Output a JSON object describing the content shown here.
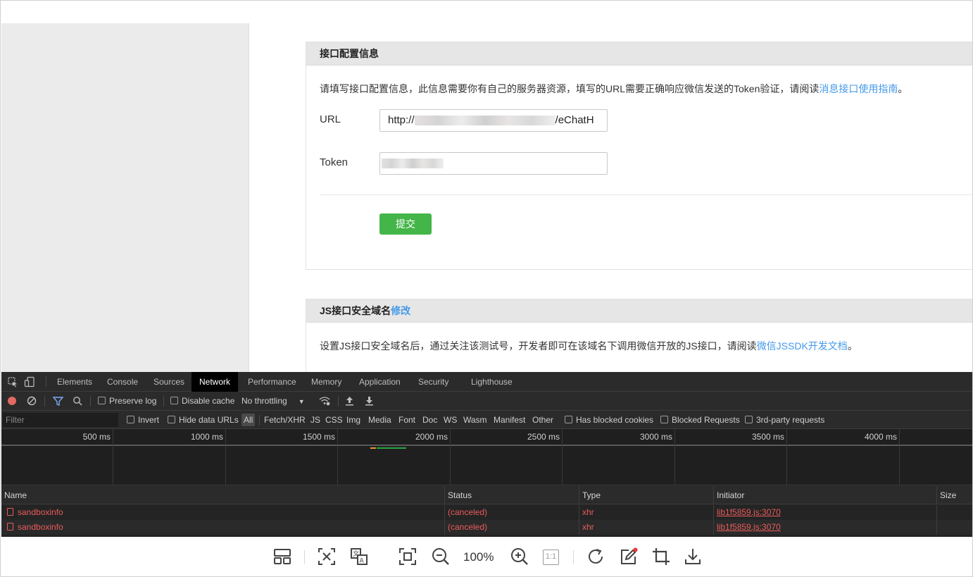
{
  "page": {
    "panel1": {
      "title": "接口配置信息",
      "desc_prefix": "请填写接口配置信息，此信息需要你有自己的服务器资源，填写的URL需要正确响应微信发送的Token验证，请阅读",
      "desc_link": "消息接口使用指南",
      "desc_suffix": "。",
      "url_label": "URL",
      "url_value_start": "http://",
      "url_value_end": "/eChatH",
      "token_label": "Token",
      "submit_label": "提交"
    },
    "panel2": {
      "title": "JS接口安全域名",
      "title_link": "修改",
      "desc_prefix": "设置JS接口安全域名后，通过关注该测试号，开发者即可在该域名下调用微信开放的JS接口，请阅读",
      "desc_link": "微信JSSDK开发文档",
      "desc_suffix": "。"
    }
  },
  "devtools": {
    "tabs": [
      "Elements",
      "Console",
      "Sources",
      "Network",
      "Performance",
      "Memory",
      "Application",
      "Security",
      "Lighthouse"
    ],
    "active_tab": "Network",
    "toolbar": {
      "preserve_log": "Preserve log",
      "disable_cache": "Disable cache",
      "throttling": "No throttling"
    },
    "filter": {
      "placeholder": "Filter",
      "invert": "Invert",
      "hide_data_urls": "Hide data URLs",
      "types": [
        "All",
        "Fetch/XHR",
        "JS",
        "CSS",
        "Img",
        "Media",
        "Font",
        "Doc",
        "WS",
        "Wasm",
        "Manifest",
        "Other"
      ],
      "has_blocked_cookies": "Has blocked cookies",
      "blocked_requests": "Blocked Requests",
      "third_party": "3rd-party requests"
    },
    "timeline_ticks": [
      "500 ms",
      "1000 ms",
      "1500 ms",
      "2000 ms",
      "2500 ms",
      "3000 ms",
      "3500 ms",
      "4000 ms"
    ],
    "columns": [
      "Name",
      "Status",
      "Type",
      "Initiator",
      "Size"
    ],
    "requests": [
      {
        "name": "sandboxinfo",
        "status": "(canceled)",
        "type": "xhr",
        "initiator": "lib1f5859.js:3070"
      },
      {
        "name": "sandboxinfo",
        "status": "(canceled)",
        "type": "xhr",
        "initiator": "lib1f5859.js:3070"
      }
    ]
  },
  "viewer": {
    "zoom": "100%",
    "icons": [
      "layout-icon",
      "ocr-text-icon",
      "translate-icon",
      "fit-screen-icon",
      "zoom-out-icon",
      "zoom-in-icon",
      "actual-size-icon",
      "rotate-icon",
      "edit-icon",
      "crop-icon",
      "download-icon"
    ],
    "actual_size_label": "1:1"
  },
  "colors": {
    "link": "#459ae9",
    "submit": "#44b549",
    "error": "#ea5b5b",
    "devtools_bg": "#242424"
  }
}
